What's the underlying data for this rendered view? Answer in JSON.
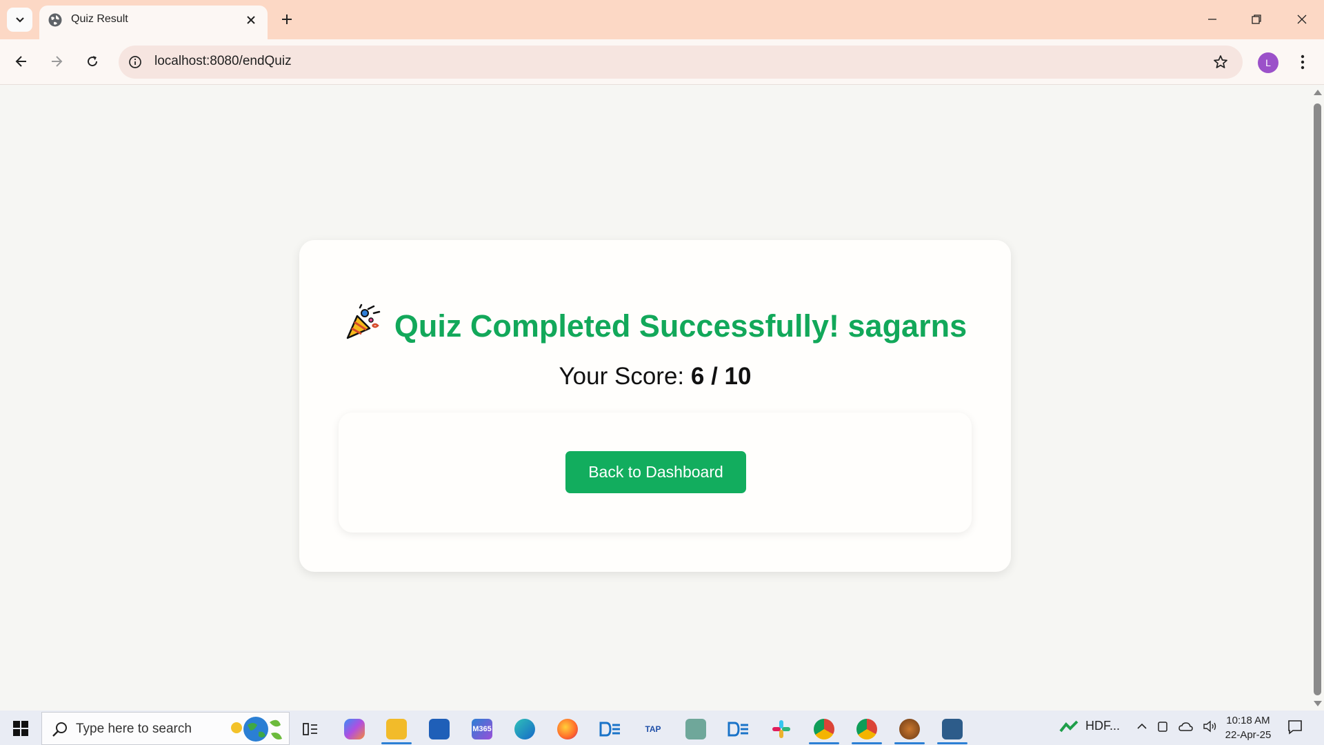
{
  "browser": {
    "tab_title": "Quiz Result",
    "url": "localhost:8080/endQuiz",
    "profile_initial": "L"
  },
  "page": {
    "heading": "Quiz Completed Successfully! sagarns",
    "score_label": "Your Score: ",
    "score_value": "6 / 10",
    "back_button_label": "Back to Dashboard",
    "accent_color": "#12a85a",
    "button_color": "#12ad5e"
  },
  "taskbar": {
    "search_placeholder": "Type here to search",
    "apps": [
      {
        "name": "task-view",
        "label": ""
      },
      {
        "name": "copilot",
        "label": ""
      },
      {
        "name": "file-explorer",
        "label": ""
      },
      {
        "name": "microsoft-store",
        "label": ""
      },
      {
        "name": "microsoft-365",
        "label": "M365"
      },
      {
        "name": "edge",
        "label": ""
      },
      {
        "name": "firefox",
        "label": ""
      },
      {
        "name": "devtools-app-1",
        "label": ""
      },
      {
        "name": "tap-academy",
        "label": "TAP"
      },
      {
        "name": "chatgpt",
        "label": ""
      },
      {
        "name": "devtools-app-2",
        "label": ""
      },
      {
        "name": "slack",
        "label": ""
      },
      {
        "name": "chrome-profile-l",
        "label": ""
      },
      {
        "name": "chrome",
        "label": ""
      },
      {
        "name": "app-badge",
        "label": ""
      },
      {
        "name": "mysql-workbench",
        "label": ""
      }
    ],
    "tray_stock_label": "HDF...",
    "time": "10:18 AM",
    "date": "22-Apr-25"
  }
}
